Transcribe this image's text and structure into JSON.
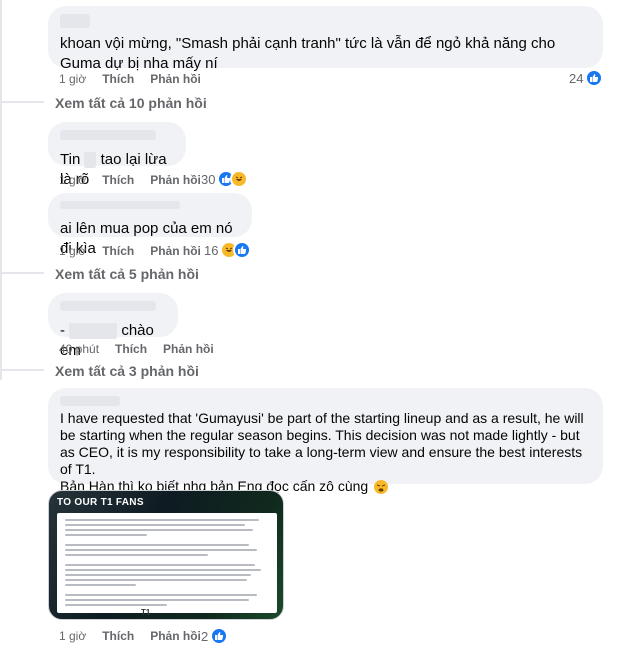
{
  "comments": [
    {
      "text": "khoan vội mừng, \"Smash phải cạnh tranh\" tức là vẫn để ngỏ khả năng cho Guma dự bị nha mấy ní",
      "time": "1 giờ",
      "like": "Thích",
      "reply": "Phản hồi",
      "reaction_count": "24"
    },
    {
      "view_more": "Xem tất cả 10 phản hồi"
    },
    {
      "text_a": "Tin",
      "text_b": "tao lại lừa là rõ",
      "time": "1 giờ",
      "like": "Thích",
      "reply": "Phản hồi",
      "reaction_count": "30"
    },
    {
      "text": "ai lên mua pop của em nó đi kìa",
      "time": "1 giờ",
      "like": "Thích",
      "reply": "Phản hồi",
      "reaction_count": "16"
    },
    {
      "view_more": "Xem tất cả 5 phản hồi"
    },
    {
      "text_a": "-",
      "text_b": "chào em",
      "time": "40 phút",
      "like": "Thích",
      "reply": "Phản hồi"
    },
    {
      "view_more": "Xem tất cả 3 phản hồi"
    },
    {
      "text": "I have requested that 'Gumayusi' be part of the starting lineup and as a result, he will be starting when the regular season begins. This decision was not made lightly - but as CEO, it is my responsibility to take a long-term view and ensure the best interests of T1.",
      "text2": "Bản Hàn thì ko biết nhg bản Eng đọc cấn zô cùng",
      "time": "1 giờ",
      "like": "Thích",
      "reply": "Phản hồi",
      "reaction_count": "2",
      "attachment": {
        "title": "TO OUR T1 FANS",
        "logo": "T1"
      }
    }
  ],
  "icons": {
    "like": "like-reaction-icon",
    "haha": "haha-reaction-icon",
    "weary": "weary-emoji-icon"
  },
  "colors": {
    "bubble": "#f0f2f5",
    "meta": "#65676b",
    "like_blue": "#1877f2",
    "haha_yellow": "#f7b928"
  }
}
